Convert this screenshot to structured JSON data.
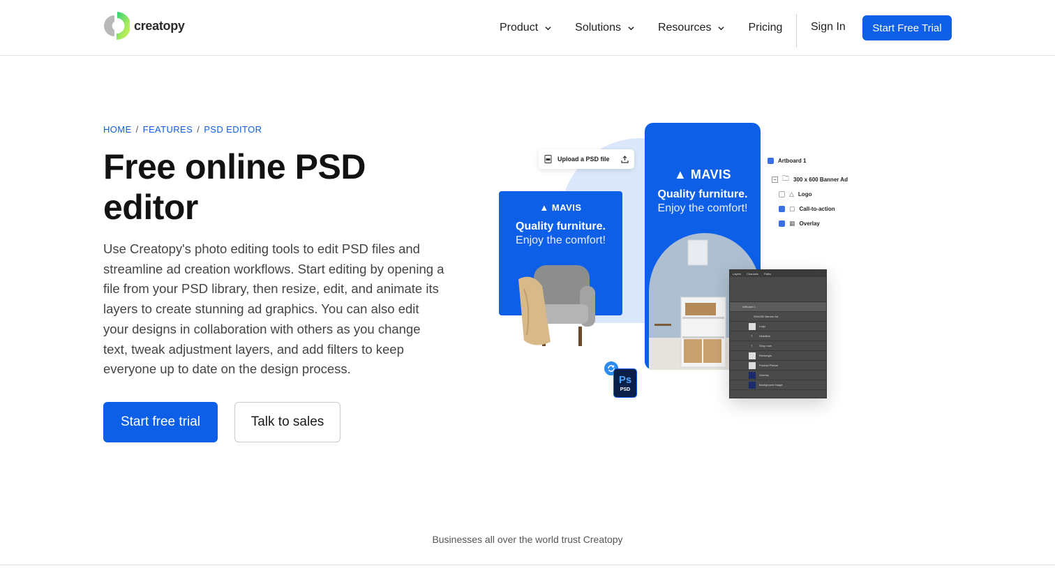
{
  "nav": {
    "logo_text": "creatopy",
    "menu": [
      {
        "label": "Product",
        "has_dropdown": true
      },
      {
        "label": "Solutions",
        "has_dropdown": true
      },
      {
        "label": "Resources",
        "has_dropdown": true
      },
      {
        "label": "Pricing",
        "has_dropdown": false
      }
    ],
    "signin_label": "Sign In",
    "trial_label": "Start Free Trial"
  },
  "breadcrumb": [
    "HOME",
    "FEATURES",
    "PSD EDITOR"
  ],
  "breadcrumb_sep": "/",
  "hero": {
    "title": "Free online PSD editor",
    "description": "Use Creatopy's photo editing tools to edit PSD files and streamline ad creation workflows. Start editing by opening a file from your PSD library, then resize, edit, and animate its layers to create stunning ad graphics. You can also edit your designs in collaboration with others as you change text, tweak adjustment layers, and add filters to keep everyone up to date on the design process.",
    "primary_cta": "Start free trial",
    "secondary_cta": "Talk to sales"
  },
  "illustration": {
    "upload_label": "Upload a PSD file",
    "ad_brand": "MAVIS",
    "ad_line1": "Quality furniture.",
    "ad_line2": "Enjoy the comfort!",
    "layers": [
      {
        "label": "Artboard 1",
        "checked": true
      },
      {
        "label": "300 x 600 Banner Ad",
        "checked": null
      },
      {
        "label": "Logo",
        "checked": false
      },
      {
        "label": "Call-to-action",
        "checked": true
      },
      {
        "label": "Overlay",
        "checked": true
      }
    ],
    "ps_tabs": [
      "Layers",
      "Channels",
      "Paths"
    ],
    "ps_layers": [
      "Artboard 1",
      "300x250 Banner Ad",
      "Logo",
      "Headline",
      "Shop now",
      "Rectangle",
      "Product Picture",
      "Overlay",
      "Background Image"
    ],
    "psd_badge_top": "Ps",
    "psd_badge_bottom": "PSD"
  },
  "trust_text": "Businesses all over the world trust Creatopy",
  "colors": {
    "accent": "#0d5fe8",
    "light_blue": "#dbe8fb"
  }
}
